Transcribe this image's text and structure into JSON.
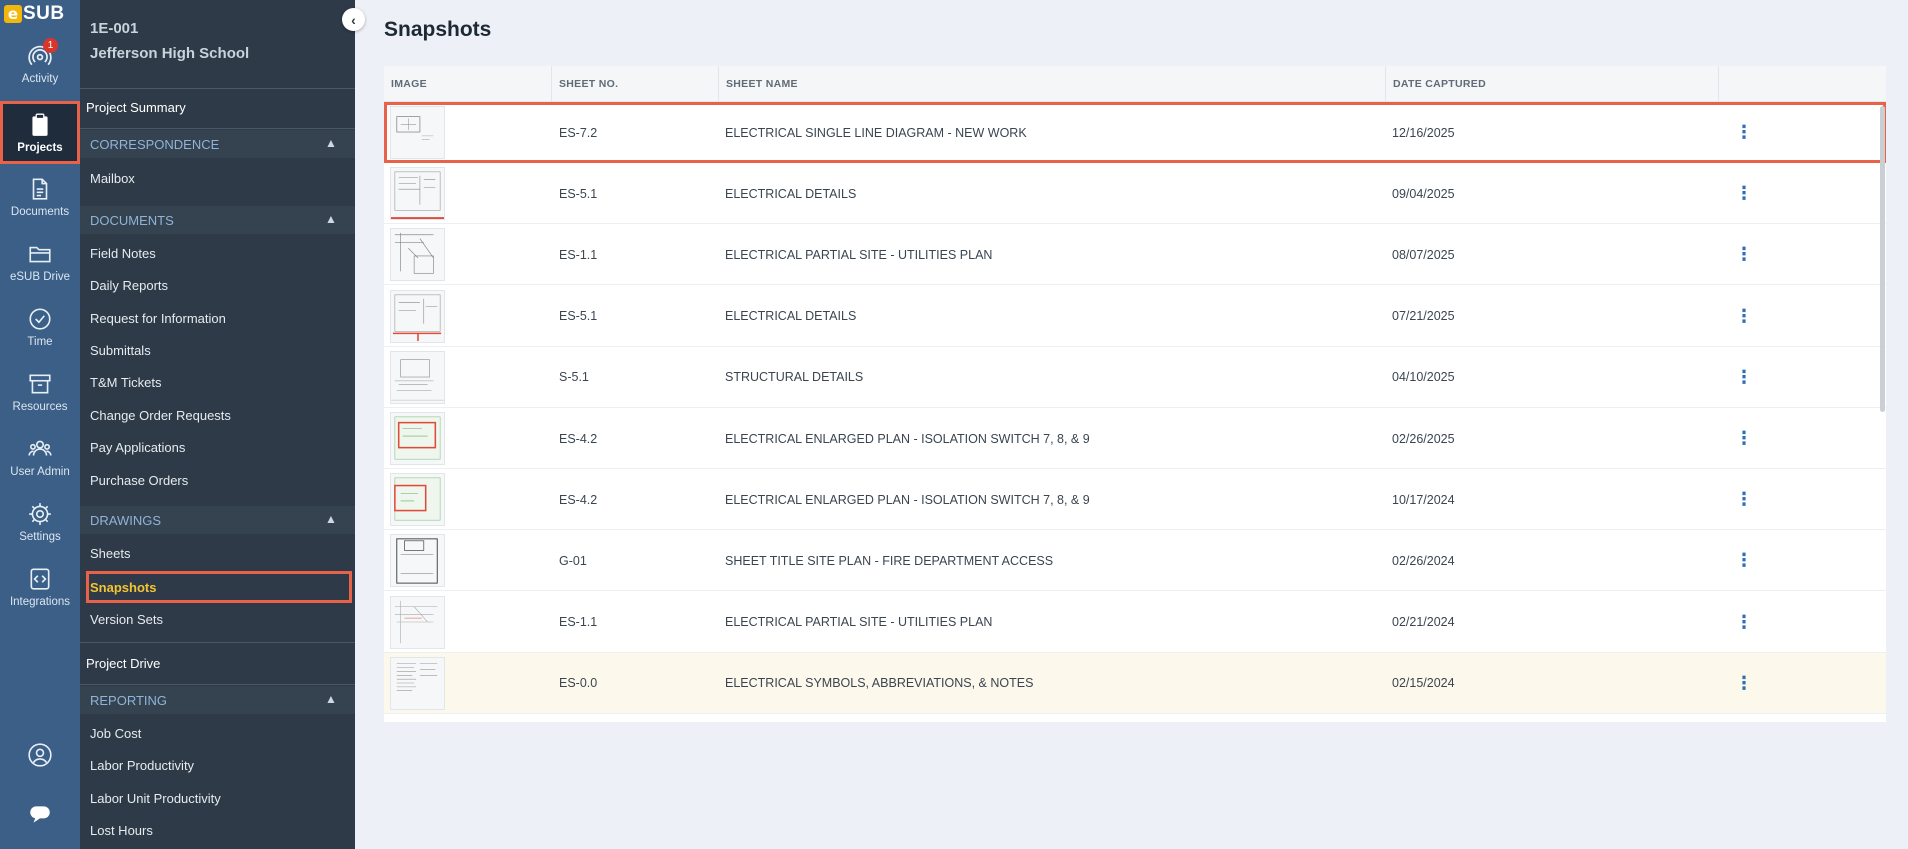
{
  "brand": {
    "logo_e": "e",
    "logo_text": "SUB"
  },
  "rail": {
    "items": [
      {
        "label": "Activity",
        "icon": "activity-icon",
        "badge": "1"
      },
      {
        "label": "Projects",
        "icon": "clipboard-icon",
        "active": true
      },
      {
        "label": "Documents",
        "icon": "document-icon"
      },
      {
        "label": "eSUB Drive",
        "icon": "folder-icon"
      },
      {
        "label": "Time",
        "icon": "clock-icon"
      },
      {
        "label": "Resources",
        "icon": "archive-icon"
      },
      {
        "label": "User Admin",
        "icon": "users-icon"
      },
      {
        "label": "Settings",
        "icon": "gear-icon"
      },
      {
        "label": "Integrations",
        "icon": "code-icon"
      }
    ],
    "bottom": [
      {
        "icon": "user-circle-icon"
      },
      {
        "icon": "chat-icon"
      }
    ]
  },
  "project": {
    "code": "1E-001",
    "name": "Jefferson High School"
  },
  "nav": {
    "project_summary": "Project Summary",
    "correspondence": {
      "title": "CORRESPONDENCE",
      "items": [
        "Mailbox"
      ]
    },
    "documents": {
      "title": "DOCUMENTS",
      "items": [
        "Field Notes",
        "Daily Reports",
        "Request for Information",
        "Submittals",
        "T&M Tickets",
        "Change Order Requests",
        "Pay Applications",
        "Purchase Orders"
      ]
    },
    "drawings": {
      "title": "DRAWINGS",
      "items": [
        "Sheets",
        "Snapshots",
        "Version Sets"
      ],
      "active": "Snapshots"
    },
    "project_drive": "Project Drive",
    "reporting": {
      "title": "REPORTING",
      "items": [
        "Job Cost",
        "Labor Productivity",
        "Labor Unit Productivity",
        "Lost Hours"
      ]
    }
  },
  "main": {
    "title": "Snapshots",
    "columns": [
      "IMAGE",
      "SHEET NO.",
      "SHEET NAME",
      "DATE CAPTURED"
    ],
    "rows": [
      {
        "sheet_no": "ES-7.2",
        "sheet_name": "ELECTRICAL SINGLE LINE DIAGRAM - NEW WORK",
        "date": "12/16/2025",
        "selected": true
      },
      {
        "sheet_no": "ES-5.1",
        "sheet_name": "ELECTRICAL DETAILS",
        "date": "09/04/2025"
      },
      {
        "sheet_no": "ES-1.1",
        "sheet_name": "ELECTRICAL PARTIAL SITE - UTILITIES PLAN",
        "date": "08/07/2025"
      },
      {
        "sheet_no": "ES-5.1",
        "sheet_name": "ELECTRICAL DETAILS",
        "date": "07/21/2025"
      },
      {
        "sheet_no": "S-5.1",
        "sheet_name": "STRUCTURAL DETAILS",
        "date": "04/10/2025"
      },
      {
        "sheet_no": "ES-4.2",
        "sheet_name": "ELECTRICAL ENLARGED PLAN - ISOLATION SWITCH 7, 8, & 9",
        "date": "02/26/2025"
      },
      {
        "sheet_no": "ES-4.2",
        "sheet_name": "ELECTRICAL ENLARGED PLAN - ISOLATION SWITCH 7, 8, & 9",
        "date": "10/17/2024"
      },
      {
        "sheet_no": "G-01",
        "sheet_name": "SHEET TITLE SITE PLAN - FIRE DEPARTMENT ACCESS",
        "date": "02/26/2024"
      },
      {
        "sheet_no": "ES-1.1",
        "sheet_name": "ELECTRICAL PARTIAL SITE - UTILITIES PLAN",
        "date": "02/21/2024"
      },
      {
        "sheet_no": "ES-0.0",
        "sheet_name": "ELECTRICAL SYMBOLS, ABBREVIATIONS, & NOTES",
        "date": "02/15/2024",
        "hovered": true
      }
    ]
  },
  "colors": {
    "rail_bg": "#3b5f86",
    "nav_bg": "#2e3a47",
    "highlight": "#e8624a",
    "active_text": "#f4c431",
    "accent": "#2f6fb5"
  }
}
